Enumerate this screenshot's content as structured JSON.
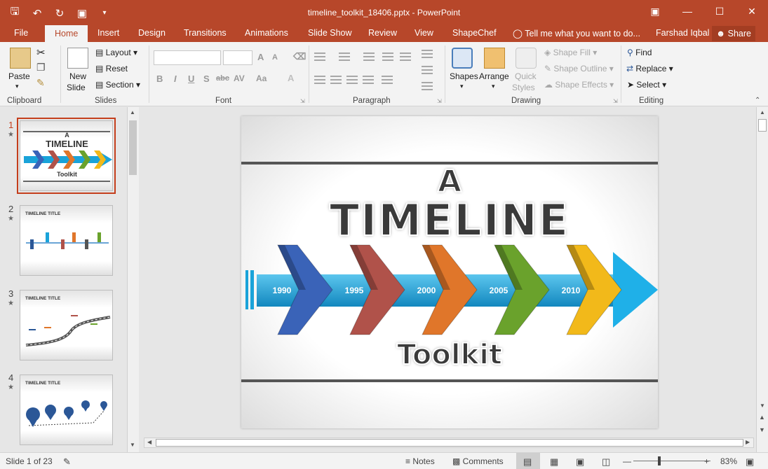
{
  "window": {
    "title": "timeline_toolkit_18406.pptx - PowerPoint",
    "icons": [
      "save-icon",
      "undo-icon",
      "redo-icon",
      "start-from-beginning-icon",
      "customize-qat-icon"
    ],
    "controls": [
      "ribbon-display-icon",
      "minimize-icon",
      "maximize-icon",
      "close-icon"
    ]
  },
  "tabs": {
    "file": "File",
    "home": "Home",
    "insert": "Insert",
    "design": "Design",
    "transitions": "Transitions",
    "animations": "Animations",
    "slideshow": "Slide Show",
    "review": "Review",
    "view": "View",
    "shapechef": "ShapeChef",
    "tell": "Tell me what you want to do...",
    "user": "Farshad Iqbal",
    "share": "Share"
  },
  "ribbon": {
    "clipboard": {
      "label": "Clipboard",
      "paste": "Paste"
    },
    "slides": {
      "label": "Slides",
      "new_slide": "New",
      "new_slide2": "Slide",
      "layout": "Layout",
      "reset": "Reset",
      "section": "Section"
    },
    "font": {
      "label": "Font",
      "bold": "B",
      "italic": "I",
      "underline": "U",
      "shadow": "S",
      "strike": "abc",
      "spacing": "AV",
      "case": "Aa",
      "grow": "A",
      "shrink": "A"
    },
    "paragraph": {
      "label": "Paragraph"
    },
    "drawing": {
      "label": "Drawing",
      "shapes": "Shapes",
      "arrange": "Arrange",
      "quick": "Quick",
      "styles": "Styles",
      "fill": "Shape Fill",
      "outline": "Shape Outline",
      "effects": "Shape Effects"
    },
    "editing": {
      "label": "Editing",
      "find": "Find",
      "replace": "Replace",
      "select": "Select"
    }
  },
  "slides_pane": {
    "slides": [
      {
        "num": "1",
        "title": ""
      },
      {
        "num": "2",
        "title": "TIMELINE TITLE"
      },
      {
        "num": "3",
        "title": "TIMELINE TITLE"
      },
      {
        "num": "4",
        "title": "TIMELINE TITLE"
      }
    ],
    "thumb1_a": "A",
    "thumb1_timeline": "TIMELINE",
    "thumb1_toolkit": "Toolkit"
  },
  "slide": {
    "a": "A",
    "timeline": "TIMELINE",
    "toolkit": "Toolkit",
    "years": [
      "1990",
      "1995",
      "2000",
      "2005",
      "2010"
    ],
    "chevron_colors": [
      "#3a63b8",
      "#b0524a",
      "#e0762a",
      "#6aa22c",
      "#f2b91a"
    ],
    "band_color": "#1aa3d9"
  },
  "status": {
    "slide": "Slide 1 of 23",
    "notes": "Notes",
    "comments": "Comments",
    "zoom": "83%"
  }
}
